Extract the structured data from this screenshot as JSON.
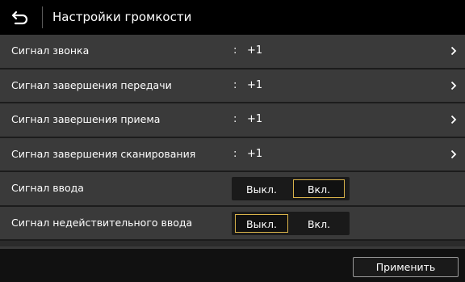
{
  "header": {
    "title": "Настройки громкости",
    "back_icon": "return-arrow-icon"
  },
  "rows": [
    {
      "label": "Сигнал звонка",
      "colon": ":",
      "value": "+1"
    },
    {
      "label": "Сигнал завершения передачи",
      "colon": ":",
      "value": "+1"
    },
    {
      "label": "Сигнал завершения приема",
      "colon": ":",
      "value": "+1"
    },
    {
      "label": "Сигнал завершения сканирования",
      "colon": ":",
      "value": "+1"
    }
  ],
  "toggles": [
    {
      "label": "Сигнал ввода",
      "off_label": "Выкл.",
      "on_label": "Вкл.",
      "selected": "on"
    },
    {
      "label": "Сигнал недействительного ввода",
      "off_label": "Выкл.",
      "on_label": "Вкл.",
      "selected": "off"
    }
  ],
  "footer": {
    "apply_label": "Применить"
  },
  "colors": {
    "accent": "#d9b34a",
    "row_bg": "#3a3a3a",
    "header_bg": "#000000"
  }
}
